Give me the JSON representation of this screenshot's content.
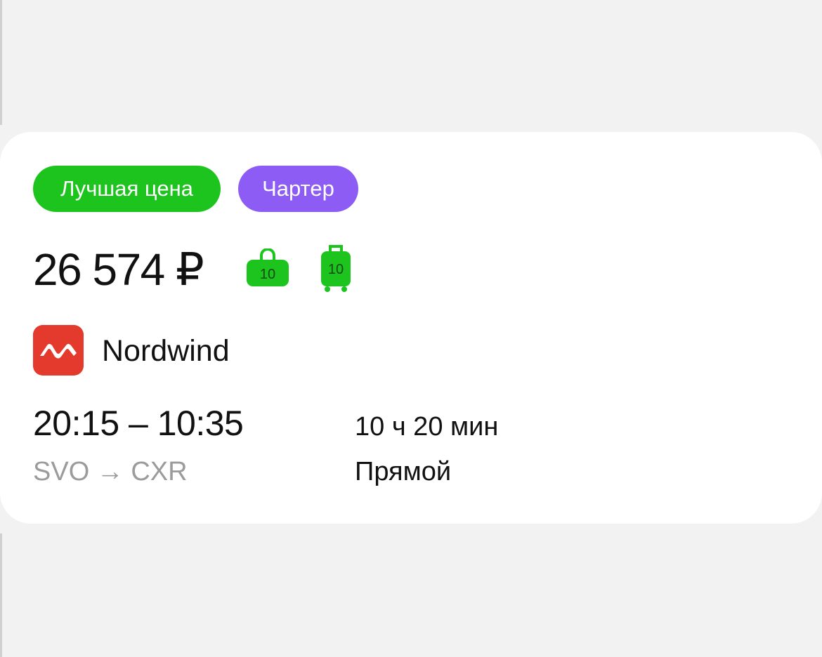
{
  "badges": {
    "best_price": "Лучшая цена",
    "charter": "Чартер"
  },
  "flight": {
    "price": "26 574 ₽",
    "hand_luggage_kg": "10",
    "checked_luggage_kg": "10",
    "airline": "Nordwind",
    "times": "20:15 – 10:35",
    "route": "SVO → CXR",
    "duration": "10 ч 20 мин",
    "stops": "Прямой"
  },
  "colors": {
    "best_price_badge": "#1ec41e",
    "charter_badge": "#8c5cf5",
    "luggage_icon": "#1ec41e",
    "airline_logo": "#e43a2e"
  },
  "icons": {
    "hand_luggage": "hand-luggage-icon",
    "checked_luggage": "suitcase-icon",
    "airline": "nordwind-logo"
  }
}
